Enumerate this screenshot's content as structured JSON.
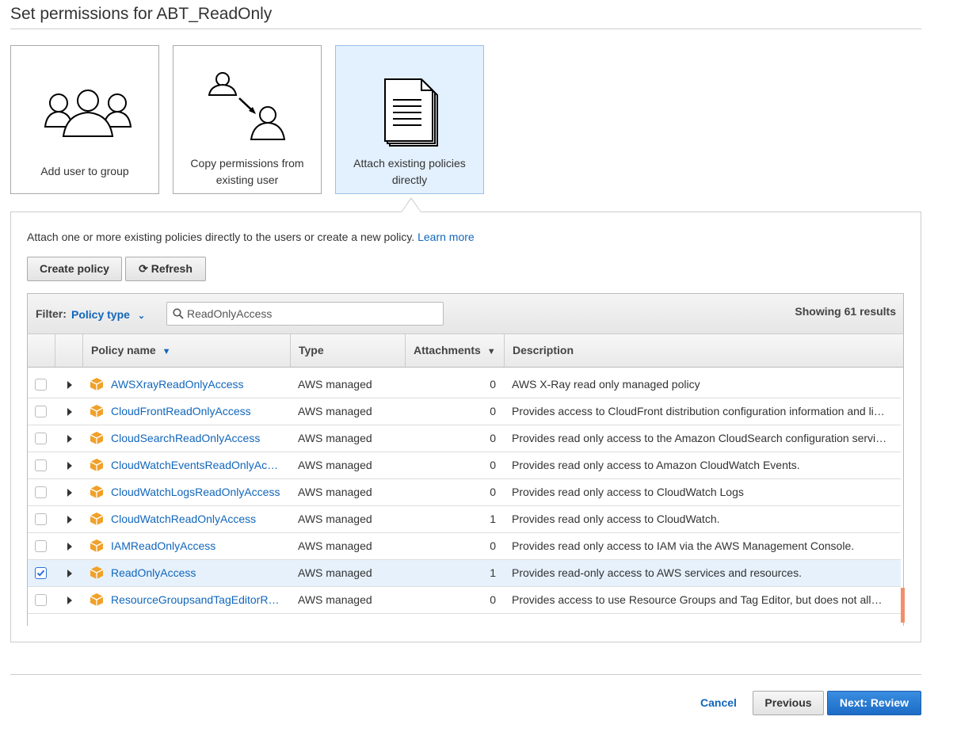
{
  "page": {
    "title": "Set permissions for ABT_ReadOnly"
  },
  "options": {
    "add_group": "Add user to group",
    "copy_user": "Copy permissions from existing user",
    "attach_policies": "Attach existing policies directly"
  },
  "panel": {
    "intro": "Attach one or more existing policies directly to the users or create a new policy.",
    "learn_more": "Learn more",
    "create_policy": "Create policy",
    "refresh": "Refresh"
  },
  "filter": {
    "label": "Filter:",
    "type": "Policy type",
    "search_value": "ReadOnlyAccess",
    "results": "Showing 61 results"
  },
  "table": {
    "columns": [
      "Policy name",
      "Type",
      "Attachments",
      "Description"
    ],
    "rows": [
      {
        "name": "AWSXrayReadOnlyAccess",
        "type": "AWS managed",
        "attachments": "0",
        "description": "AWS X-Ray read only managed policy",
        "checked": false
      },
      {
        "name": "CloudFrontReadOnlyAccess",
        "type": "AWS managed",
        "attachments": "0",
        "description": "Provides access to CloudFront distribution configuration information and li…",
        "checked": false
      },
      {
        "name": "CloudSearchReadOnlyAccess",
        "type": "AWS managed",
        "attachments": "0",
        "description": "Provides read only access to the Amazon CloudSearch configuration servi…",
        "checked": false
      },
      {
        "name": "CloudWatchEventsReadOnlyAc…",
        "type": "AWS managed",
        "attachments": "0",
        "description": "Provides read only access to Amazon CloudWatch Events.",
        "checked": false
      },
      {
        "name": "CloudWatchLogsReadOnlyAccess",
        "type": "AWS managed",
        "attachments": "0",
        "description": "Provides read only access to CloudWatch Logs",
        "checked": false
      },
      {
        "name": "CloudWatchReadOnlyAccess",
        "type": "AWS managed",
        "attachments": "1",
        "description": "Provides read only access to CloudWatch.",
        "checked": false
      },
      {
        "name": "IAMReadOnlyAccess",
        "type": "AWS managed",
        "attachments": "0",
        "description": "Provides read only access to IAM via the AWS Management Console.",
        "checked": false
      },
      {
        "name": "ReadOnlyAccess",
        "type": "AWS managed",
        "attachments": "1",
        "description": "Provides read-only access to AWS services and resources.",
        "checked": true
      },
      {
        "name": "ResourceGroupsandTagEditorR…",
        "type": "AWS managed",
        "attachments": "0",
        "description": "Provides access to use Resource Groups and Tag Editor, but does not all…",
        "checked": false
      }
    ]
  },
  "footer": {
    "cancel": "Cancel",
    "previous": "Previous",
    "next": "Next: Review"
  },
  "colors": {
    "link": "#1166bb",
    "selected_bg": "#e3f0fd",
    "primary": "#1d6cc6",
    "package_icon": "#f0a12a"
  }
}
